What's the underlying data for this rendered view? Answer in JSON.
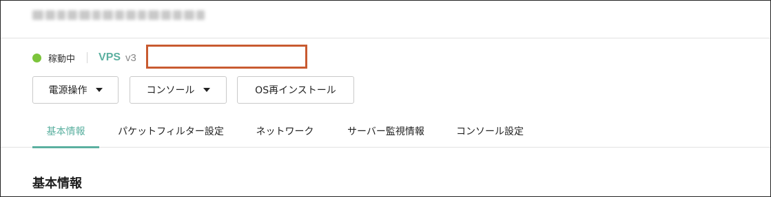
{
  "header": {
    "title_redacted": true
  },
  "server": {
    "status_label": "稼動中",
    "status_color": "#7cc43b",
    "product_name": "VPS",
    "version": "v3",
    "name_redacted": true,
    "accent_color": "#5bb0a0",
    "redaction_color": "#c85a30"
  },
  "toolbar": {
    "power_label": "電源操作",
    "console_label": "コンソール",
    "reinstall_label": "OS再インストール"
  },
  "tabs": [
    {
      "label": "基本情報",
      "active": true
    },
    {
      "label": "パケットフィルター設定",
      "active": false
    },
    {
      "label": "ネットワーク",
      "active": false
    },
    {
      "label": "サーバー監視情報",
      "active": false
    },
    {
      "label": "コンソール設定",
      "active": false
    }
  ],
  "main": {
    "section_title": "基本情報"
  }
}
